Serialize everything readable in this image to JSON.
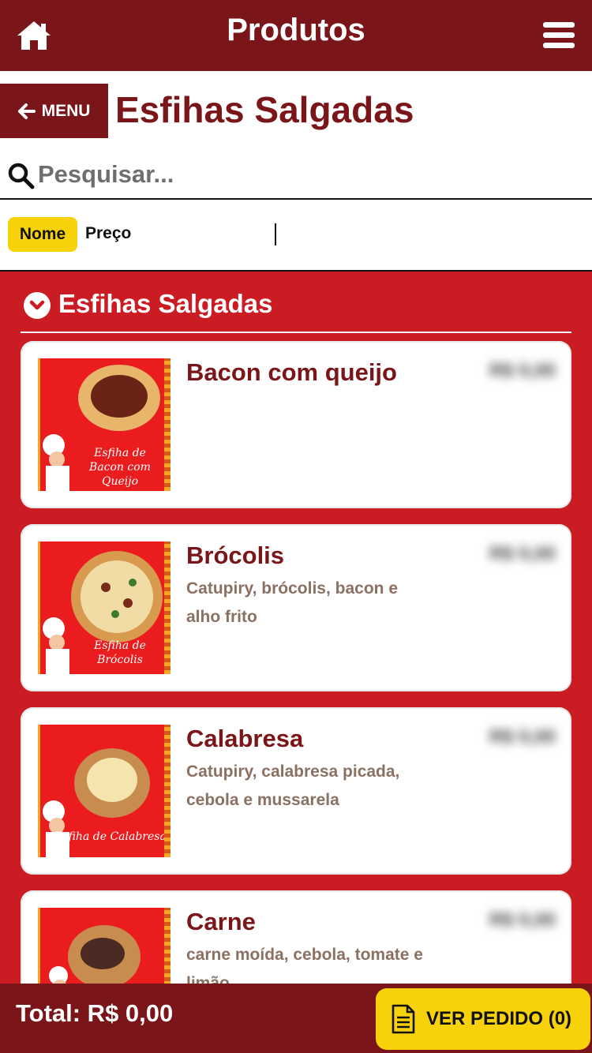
{
  "header": {
    "title": "Produtos",
    "home_icon": "home-icon",
    "menu_icon": "hamburger-menu-icon"
  },
  "nav": {
    "back_label": "MENU",
    "category_title": "Esfihas Salgadas"
  },
  "search": {
    "placeholder": "Pesquisar..."
  },
  "sort": {
    "options": [
      "Nome",
      "Preço"
    ],
    "selected": "Nome"
  },
  "section": {
    "title": "Esfihas Salgadas",
    "products": [
      {
        "name": "Bacon com queijo",
        "description": "",
        "price": "R$ 0,00",
        "image_caption": "Esfiha de Bacon com Queijo"
      },
      {
        "name": "Brócolis",
        "description": "Catupiry, brócolis, bacon e alho frito",
        "price": "R$ 0,00",
        "image_caption": "Esfiha de Brócolis"
      },
      {
        "name": "Calabresa",
        "description": "Catupiry, calabresa picada, cebola e mussarela",
        "price": "R$ 0,00",
        "image_caption": "Esfiha de Calabresa"
      },
      {
        "name": "Carne",
        "description": "carne moída, cebola, tomate e limão",
        "price": "R$ 0,00",
        "image_caption": ""
      }
    ]
  },
  "footer": {
    "total": "Total: R$ 0,00",
    "order_button": "VER PEDIDO (0)"
  },
  "colors": {
    "brand_dark": "#7a161a",
    "brand_red": "#cb1c24",
    "accent_yellow": "#f7d20a"
  }
}
